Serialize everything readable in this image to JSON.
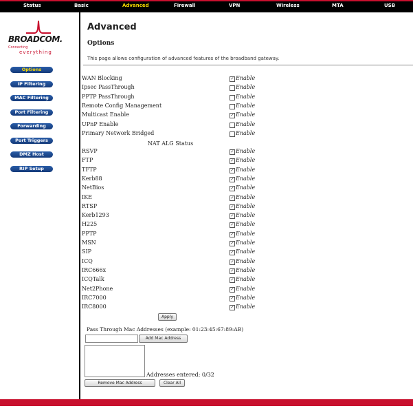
{
  "nav": {
    "tabs": [
      {
        "label": "Status",
        "active": false
      },
      {
        "label": "Basic",
        "active": false
      },
      {
        "label": "Advanced",
        "active": true
      },
      {
        "label": "Firewall",
        "active": false
      },
      {
        "label": "VPN",
        "active": false
      },
      {
        "label": "Wireless",
        "active": false
      },
      {
        "label": "MTA",
        "active": false
      },
      {
        "label": "USB",
        "active": false
      }
    ],
    "active_color": "#f6d800"
  },
  "logo": {
    "word": "BROADCOM.",
    "tagline_top": "Connecting",
    "tagline_bottom": "everything"
  },
  "sidebar": {
    "items": [
      {
        "label": "Options",
        "active": true
      },
      {
        "label": "IP Filtering",
        "active": false
      },
      {
        "label": "MAC Filtering",
        "active": false
      },
      {
        "label": "Port Filtering",
        "active": false
      },
      {
        "label": "Forwarding",
        "active": false
      },
      {
        "label": "Port Triggers",
        "active": false
      },
      {
        "label": "DMZ Host",
        "active": false
      },
      {
        "label": "RIP Setup",
        "active": false
      }
    ]
  },
  "page": {
    "title": "Advanced",
    "subtitle": "Options",
    "description": "This page allows configuration of advanced features of the broadband gateway."
  },
  "options": [
    {
      "label": "WAN Blocking",
      "checked": true,
      "enable": "Enable"
    },
    {
      "label": "Ipsec PassThrough",
      "checked": false,
      "enable": "Enable"
    },
    {
      "label": "PPTP PassThrough",
      "checked": false,
      "enable": "Enable"
    },
    {
      "label": "Remote Config Management",
      "checked": false,
      "enable": "Enable"
    },
    {
      "label": "Multicast Enable",
      "checked": true,
      "enable": "Enable"
    },
    {
      "label": "UPnP Enable",
      "checked": false,
      "enable": "Enable"
    },
    {
      "label": "Primary Network Bridged",
      "checked": false,
      "enable": "Enable"
    }
  ],
  "nat_alg_heading": "NAT ALG Status",
  "nat_alg": [
    {
      "label": "RSVP",
      "checked": true,
      "enable": "Enable"
    },
    {
      "label": "FTP",
      "checked": true,
      "enable": "Enable"
    },
    {
      "label": "TFTP",
      "checked": true,
      "enable": "Enable"
    },
    {
      "label": "Kerb88",
      "checked": true,
      "enable": "Enable"
    },
    {
      "label": "NetBios",
      "checked": true,
      "enable": "Enable"
    },
    {
      "label": "IKE",
      "checked": true,
      "enable": "Enable"
    },
    {
      "label": "RTSP",
      "checked": true,
      "enable": "Enable"
    },
    {
      "label": "Kerb1293",
      "checked": true,
      "enable": "Enable"
    },
    {
      "label": "H225",
      "checked": true,
      "enable": "Enable"
    },
    {
      "label": "PPTP",
      "checked": true,
      "enable": "Enable"
    },
    {
      "label": "MSN",
      "checked": true,
      "enable": "Enable"
    },
    {
      "label": "SIP",
      "checked": true,
      "enable": "Enable"
    },
    {
      "label": "ICQ",
      "checked": true,
      "enable": "Enable"
    },
    {
      "label": "IRC666x",
      "checked": true,
      "enable": "Enable"
    },
    {
      "label": "ICQTalk",
      "checked": true,
      "enable": "Enable"
    },
    {
      "label": "Net2Phone",
      "checked": true,
      "enable": "Enable"
    },
    {
      "label": "IRC7000",
      "checked": true,
      "enable": "Enable"
    },
    {
      "label": "IRC8000",
      "checked": true,
      "enable": "Enable"
    }
  ],
  "apply_label": "Apply",
  "mac": {
    "label": "Pass Through Mac Addresses (example: 01:23:45:67:89:AB)",
    "input_value": "",
    "add_label": "Add Mac Address",
    "entered_text": "Addresses entered: 0/32",
    "remove_label": "Remove Mac Address",
    "clear_label": "Clear All"
  },
  "colors": {
    "brand_red": "#c8102e",
    "nav_blue": "#1f4f97"
  }
}
